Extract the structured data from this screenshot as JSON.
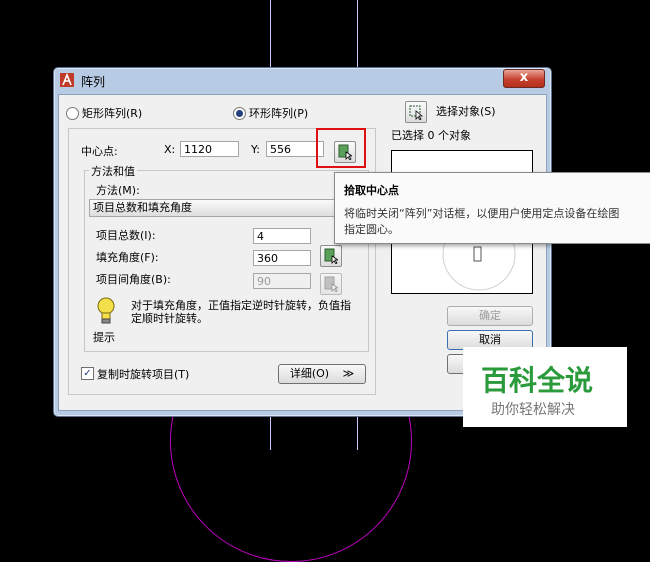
{
  "window": {
    "title": "阵列",
    "close_label": "x"
  },
  "array_type": {
    "rect_label": "矩形阵列(R)",
    "polar_label": "环形阵列(P)",
    "selected": "polar"
  },
  "center_point": {
    "label": "中心点:",
    "x_label": "X:",
    "x_value": "1120",
    "y_label": "Y:",
    "y_value": "556"
  },
  "method_group": {
    "title": "方法和值",
    "method_label": "方法(M):",
    "method_value": "项目总数和填充角度",
    "total_items_label": "项目总数(I):",
    "total_items_value": "4",
    "fill_angle_label": "填充角度(F):",
    "fill_angle_value": "360",
    "item_angle_label": "项目间角度(B):",
    "item_angle_value": "90"
  },
  "hint": {
    "text": "对于填充角度，正值指定逆时针旋转，负值指定顺时针旋转。",
    "label": "提示"
  },
  "rotate_items": {
    "label": "复制时旋转项目(T)",
    "checked": true
  },
  "details_button": {
    "label": "详细(O)",
    "arrow": "≫"
  },
  "select_objects": {
    "label": "选择对象(S)",
    "status": "已选择 0 个对象"
  },
  "buttons": {
    "ok": "确定",
    "cancel": "取消"
  },
  "tooltip": {
    "title": "拾取中心点",
    "body": "将临时关闭“阵列”对话框，以便用户使用定点设备在绘图",
    "body2": "指定圆心。"
  },
  "watermark": {
    "main": "百科全说",
    "sub": "助你轻松解决"
  },
  "colors": {
    "cad_background": "#000000",
    "dialog_frame": "#b7cbe4",
    "close_button": "#c8412e",
    "highlight_box": "#e01010",
    "watermark_green": "#2a9a3a",
    "arc": "#c000c0"
  }
}
